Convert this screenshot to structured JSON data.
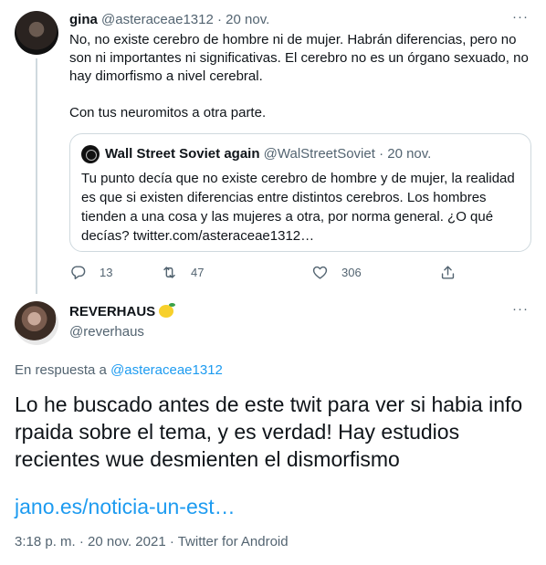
{
  "tweet1": {
    "name": "gina",
    "handle": "@asteraceae1312",
    "separator": "·",
    "date": "20 nov.",
    "more_label": "···",
    "body_p1": "No, no existe cerebro de hombre ni de mujer. Habrán diferencias, pero no son ni importantes ni significativas. El cerebro no es un órgano sexuado, no hay dimorfismo a nivel cerebral.",
    "body_p2": "Con tus neuromitos a otra parte.",
    "quote": {
      "name": "Wall Street Soviet again",
      "handle": "@WalStreetSoviet",
      "separator": "·",
      "date": "20 nov.",
      "body": "Tu punto decía que no existe cerebro de hombre y de mujer, la realidad es que si existen diferencias entre distintos cerebros. Los hombres tienden a una cosa y las mujeres a otra, por norma general. ¿O qué decías? twitter.com/asteraceae1312…"
    },
    "actions": {
      "reply_count": "13",
      "retweet_count": "47",
      "like_count": "306",
      "reply_icon": "reply-icon",
      "retweet_icon": "retweet-icon",
      "like_icon": "heart-icon",
      "share_icon": "share-icon"
    }
  },
  "tweet2": {
    "name": "REVERHAUS",
    "emoji": "lemon-icon",
    "handle": "@reverhaus",
    "more_label": "···",
    "reply_prefix": "En respuesta a",
    "reply_handle": "@asteraceae1312",
    "body": "Lo he buscado antes de este twit para ver si habia info rpaida sobre el tema, y es verdad! Hay estudios recientes wue desmienten el dismorfismo",
    "link": "jano.es/noticia-un-est…",
    "meta": "3:18 p. m. · 20 nov. 2021 · Twitter for Android"
  },
  "colors": {
    "text": "#0f1419",
    "muted": "#536471",
    "link": "#1d9bf0",
    "border": "#cfd9de"
  }
}
